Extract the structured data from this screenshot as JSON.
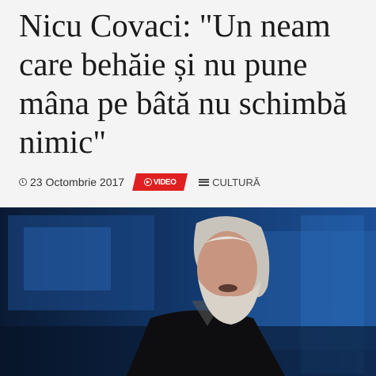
{
  "headline": "Nicu Covaci: \"Un neam care behăie și nu pune mâna pe bâtă nu schimbă nimic\"",
  "meta": {
    "date": "23 Octombrie 2017",
    "video_label": "VIDEO",
    "category": "CULTURĂ"
  },
  "icons": {
    "date": "clock-icon",
    "video": "play-circle-icon",
    "category": "menu-lines-icon"
  },
  "colors": {
    "accent_red": "#e02020",
    "headline_text": "#1a1a1a",
    "header_bg": "#f4f4f4",
    "studio_blue": "#1a4a8c"
  }
}
